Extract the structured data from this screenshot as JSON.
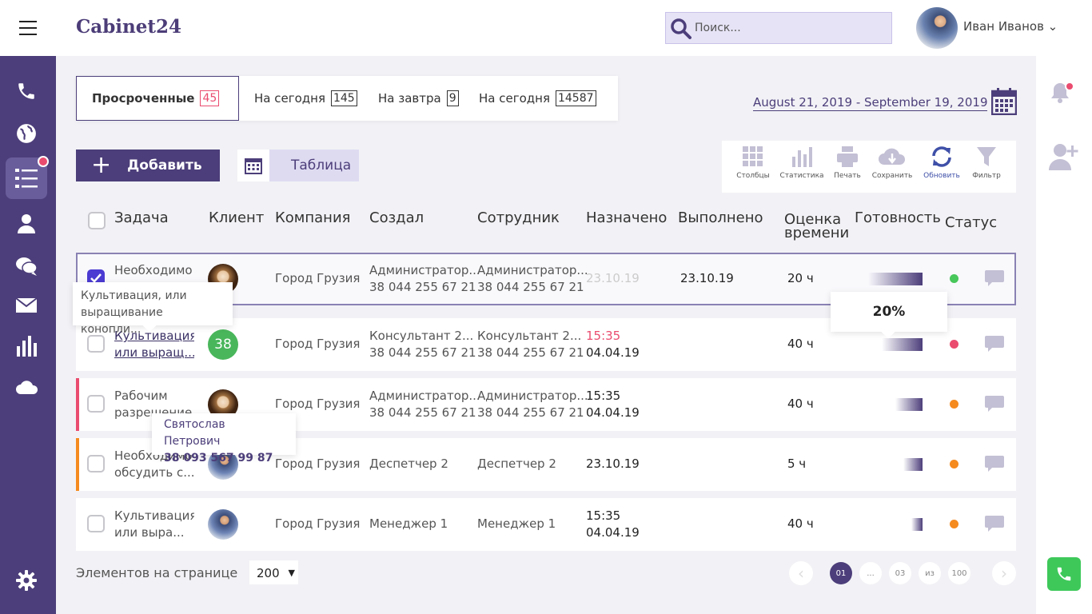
{
  "app": {
    "logo": "Cabinet24"
  },
  "search": {
    "placeholder": "Поиск..."
  },
  "user": {
    "name": "Иван Иванов ⌄"
  },
  "sidebar": {
    "items": [
      "phone-icon",
      "globe-icon",
      "tasks-list-icon",
      "user-icon",
      "chat-icon",
      "mail-icon",
      "stats-icon",
      "cloud-icon",
      "settings-icon"
    ],
    "notification": true
  },
  "tabs": [
    {
      "label": "Просроченные",
      "count": "45"
    },
    {
      "label": "На сегодня",
      "count": "145"
    },
    {
      "label": "На завтра",
      "count": "9"
    },
    {
      "label": "На сегодня",
      "count": "14587"
    }
  ],
  "date_range": "August 21, 2019 - September 19, 2019",
  "add_button": {
    "label": "Добавить"
  },
  "view_toggle": {
    "label": "Таблица"
  },
  "toolbar": [
    {
      "label": "Столбцы",
      "icon": "columns-icon"
    },
    {
      "label": "Статистика",
      "icon": "statistics-icon"
    },
    {
      "label": "Печать",
      "icon": "print-icon"
    },
    {
      "label": "Сохранить",
      "icon": "download-icon"
    },
    {
      "label": "Обновить",
      "icon": "refresh-icon"
    },
    {
      "label": "Фильтр",
      "icon": "filter-icon"
    }
  ],
  "columns": [
    "Задача",
    "Клиент",
    "Компания",
    "Создал",
    "Сотрудник",
    "Назначено",
    "Выполнено",
    "Оценка",
    "времени",
    "Готовность",
    "Статус"
  ],
  "rows": [
    {
      "task1": "Необходимо",
      "task2": "",
      "client": "",
      "company": "Город Грузия",
      "created1": "Администратор...",
      "created2": "38 044 255 67 21",
      "employee1": "Администратор...",
      "employee2": "38 044 255 67 21",
      "assigned1": "23.10.19",
      "assigned2": "",
      "done": "23.10.19",
      "estimate": "20 ч",
      "progress": 0.2,
      "status_color": "#48c75a",
      "checked": true
    },
    {
      "task1": "Культивация,",
      "task2": "или выращ...",
      "client": "38",
      "company": "Город Грузия",
      "created1": "Консультант 2...",
      "created2": "38 044 255 67 21",
      "employee1": "Консультант 2...",
      "employee2": "38 044 255 67 21",
      "assigned1": "15:35",
      "assigned2": "04.04.19",
      "done": "",
      "estimate": "40 ч",
      "progress": 0.15,
      "status_color": "#ea4c6f",
      "checked": false
    },
    {
      "task1": "Рабочим",
      "task2": "разрешение...",
      "client": "",
      "company": "Город Грузия",
      "created1": "Администратор...",
      "created2": "38 044 255 67 21",
      "employee1": "Администратор...",
      "employee2": "38 044 255 67 21",
      "assigned1": "15:35",
      "assigned2": "04.04.19",
      "done": "",
      "estimate": "40 ч",
      "progress": 0.1,
      "status_color": "#f58a1f",
      "checked": false
    },
    {
      "task1": "Необходимо",
      "task2": "обсудить с...",
      "client": "",
      "company": "Город Грузия",
      "created1": "Деспетчер 2",
      "created2": "",
      "employee1": "Деспетчер 2",
      "employee2": "",
      "assigned1": "23.10.19",
      "assigned2": "",
      "done": "",
      "estimate": "5 ч",
      "progress": 0.07,
      "status_color": "#f58a1f",
      "checked": false
    },
    {
      "task1": "Культивация,",
      "task2": "или выра...",
      "client": "",
      "company": "Город Грузия",
      "created1": "Менеджер 1",
      "created2": "",
      "employee1": "Менеджер 1",
      "employee2": "",
      "assigned1": "15:35",
      "assigned2": "04.04.19",
      "done": "",
      "estimate": "40 ч",
      "progress": 0.04,
      "status_color": "#f58a1f",
      "checked": false
    }
  ],
  "tooltip_task": {
    "line1": "Культивация, или",
    "line2": "выращивание конопли..."
  },
  "tooltip_progress": {
    "text": "20%"
  },
  "tooltip_contact": {
    "name": "Святослав Петрович",
    "phone": "38 093 567 99 87"
  },
  "footer": {
    "per_page_label": "Элементов на странице",
    "per_page_value": "200"
  },
  "pagination": {
    "pages": [
      "01",
      "...",
      "03",
      "из",
      "100"
    ],
    "current": "01"
  },
  "colors": {
    "primary": "#4c3e7a",
    "accent_red": "#ea4c6f",
    "green": "#3ec85a",
    "orange": "#f58a1f"
  }
}
